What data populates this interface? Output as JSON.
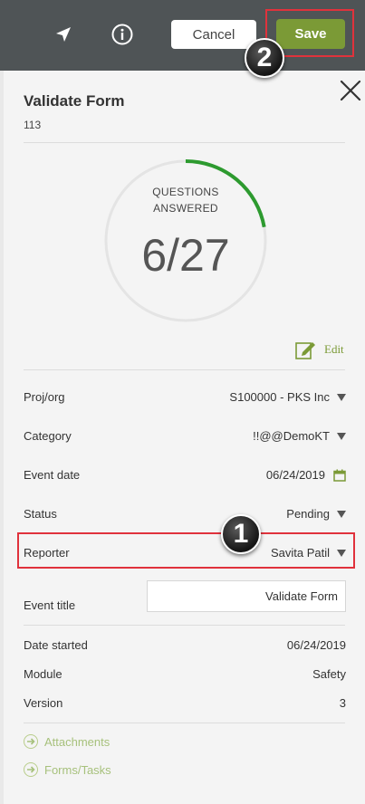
{
  "topbar": {
    "location_icon": "location-arrow-icon",
    "info_icon": "info-circle-icon",
    "cancel_label": "Cancel",
    "save_label": "Save"
  },
  "callouts": {
    "save": "2",
    "reporter": "1"
  },
  "form": {
    "title": "Validate Form",
    "id": "113",
    "progress": {
      "caption_line1": "QUESTIONS",
      "caption_line2": "ANSWERED",
      "value_text": "6/27",
      "answered": 6,
      "total": 27
    },
    "edit_label": "Edit",
    "fields": [
      {
        "label": "Proj/org",
        "value": "S100000 - PKS Inc",
        "control": "dropdown"
      },
      {
        "label": "Category",
        "value": "!!@@DemoKT",
        "control": "dropdown"
      },
      {
        "label": "Event date",
        "value": "06/24/2019",
        "control": "date"
      },
      {
        "label": "Status",
        "value": "Pending",
        "control": "dropdown"
      },
      {
        "label": "Reporter",
        "value": "Savita Patil",
        "control": "dropdown"
      }
    ],
    "event_title": {
      "label": "Event title",
      "value": "Validate Form"
    },
    "info": [
      {
        "label": "Date started",
        "value": "06/24/2019"
      },
      {
        "label": "Module",
        "value": "Safety"
      },
      {
        "label": "Version",
        "value": "3"
      }
    ],
    "links": [
      {
        "label": "Attachments"
      },
      {
        "label": "Forms/Tasks"
      }
    ]
  },
  "colors": {
    "accent": "#7b9a36",
    "highlight": "#e0323c",
    "progress_arc": "#2d9a2f",
    "topbar": "#4f5456"
  }
}
